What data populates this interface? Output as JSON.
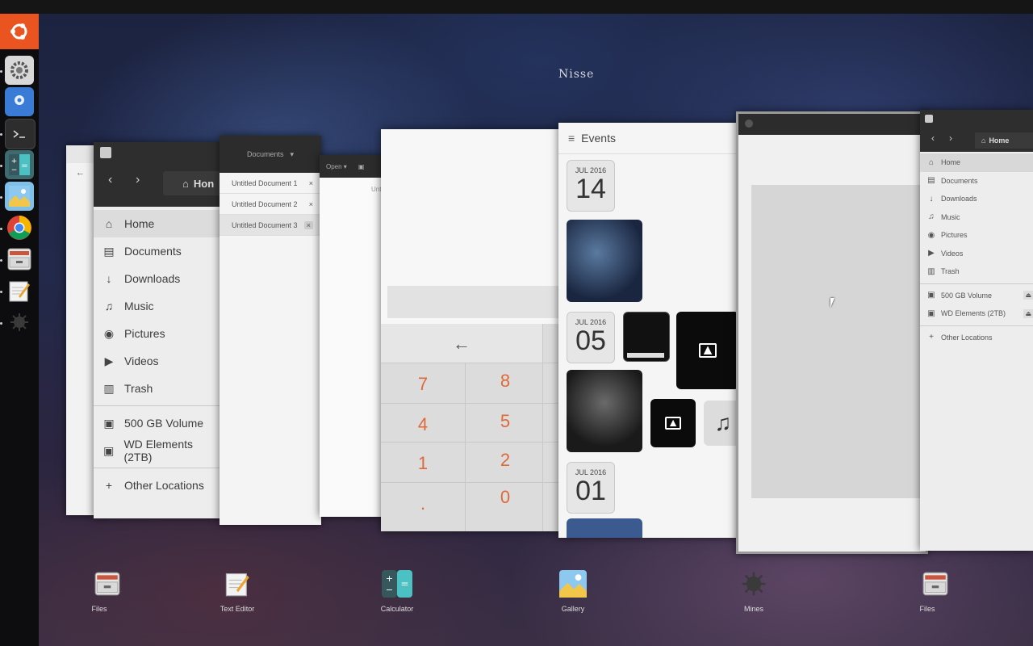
{
  "workspace": {
    "title": "Nisse"
  },
  "files_left": {
    "path_label": "Hon",
    "sidebar": [
      {
        "label": "Home",
        "icon": "home-icon",
        "glyph": "⌂"
      },
      {
        "label": "Documents",
        "icon": "document-icon",
        "glyph": "▤"
      },
      {
        "label": "Downloads",
        "icon": "download-icon",
        "glyph": "↓"
      },
      {
        "label": "Music",
        "icon": "music-icon",
        "glyph": "♫"
      },
      {
        "label": "Pictures",
        "icon": "camera-icon",
        "glyph": "◉"
      },
      {
        "label": "Videos",
        "icon": "video-icon",
        "glyph": "▶"
      },
      {
        "label": "Trash",
        "icon": "trash-icon",
        "glyph": "▥"
      }
    ],
    "volumes": [
      {
        "label": "500 GB Volume",
        "icon": "drive-icon"
      },
      {
        "label": "WD Elements (2TB)",
        "icon": "drive-icon"
      }
    ],
    "other": {
      "label": "Other Locations",
      "icon": "plus-icon"
    }
  },
  "text_editor": {
    "menu_label": "Documents",
    "open_label": "Open",
    "tabs": [
      "Untitled Document 1",
      "Untitled Document 2",
      "Untitled Document 3"
    ],
    "secondary_title": "Unti"
  },
  "calculator": {
    "keys": [
      "←",
      "7",
      "8",
      "4",
      "5",
      "1",
      "2",
      ".",
      "0"
    ]
  },
  "gallery": {
    "title": "Events",
    "events": [
      {
        "month": "JUL 2016",
        "day": "14"
      },
      {
        "month": "JUL 2016",
        "day": "05"
      },
      {
        "month": "JUL 2016",
        "day": "01"
      }
    ]
  },
  "files_right": {
    "path_label": "Home",
    "sidebar": [
      {
        "label": "Home",
        "glyph": "⌂"
      },
      {
        "label": "Documents",
        "glyph": "▤"
      },
      {
        "label": "Downloads",
        "glyph": "↓"
      },
      {
        "label": "Music",
        "glyph": "♫"
      },
      {
        "label": "Pictures",
        "glyph": "◉"
      },
      {
        "label": "Videos",
        "glyph": "▶"
      },
      {
        "label": "Trash",
        "glyph": "▥"
      }
    ],
    "volumes": [
      "500 GB Volume",
      "WD Elements (2TB)"
    ],
    "other": "Other Locations"
  },
  "dock": [
    {
      "label": "Files",
      "icon": "files-app-icon"
    },
    {
      "label": "Text Editor",
      "icon": "text-editor-app-icon"
    },
    {
      "label": "Calculator",
      "icon": "calculator-app-icon"
    },
    {
      "label": "Gallery",
      "icon": "gallery-app-icon"
    },
    {
      "label": "Mines",
      "icon": "mines-app-icon"
    },
    {
      "label": "Files",
      "icon": "files-app-icon"
    }
  ],
  "launcher": [
    {
      "name": "ubuntu-logo-icon"
    },
    {
      "name": "settings-app-icon"
    },
    {
      "name": "maps-app-icon"
    },
    {
      "name": "terminal-app-icon"
    },
    {
      "name": "calculator-app-icon"
    },
    {
      "name": "gallery-app-icon"
    },
    {
      "name": "chrome-app-icon"
    },
    {
      "name": "files-app-icon"
    },
    {
      "name": "text-editor-app-icon"
    },
    {
      "name": "mines-app-icon"
    }
  ],
  "colors": {
    "launcher_accent": "#e95420",
    "calc_key": "#e0693a"
  }
}
